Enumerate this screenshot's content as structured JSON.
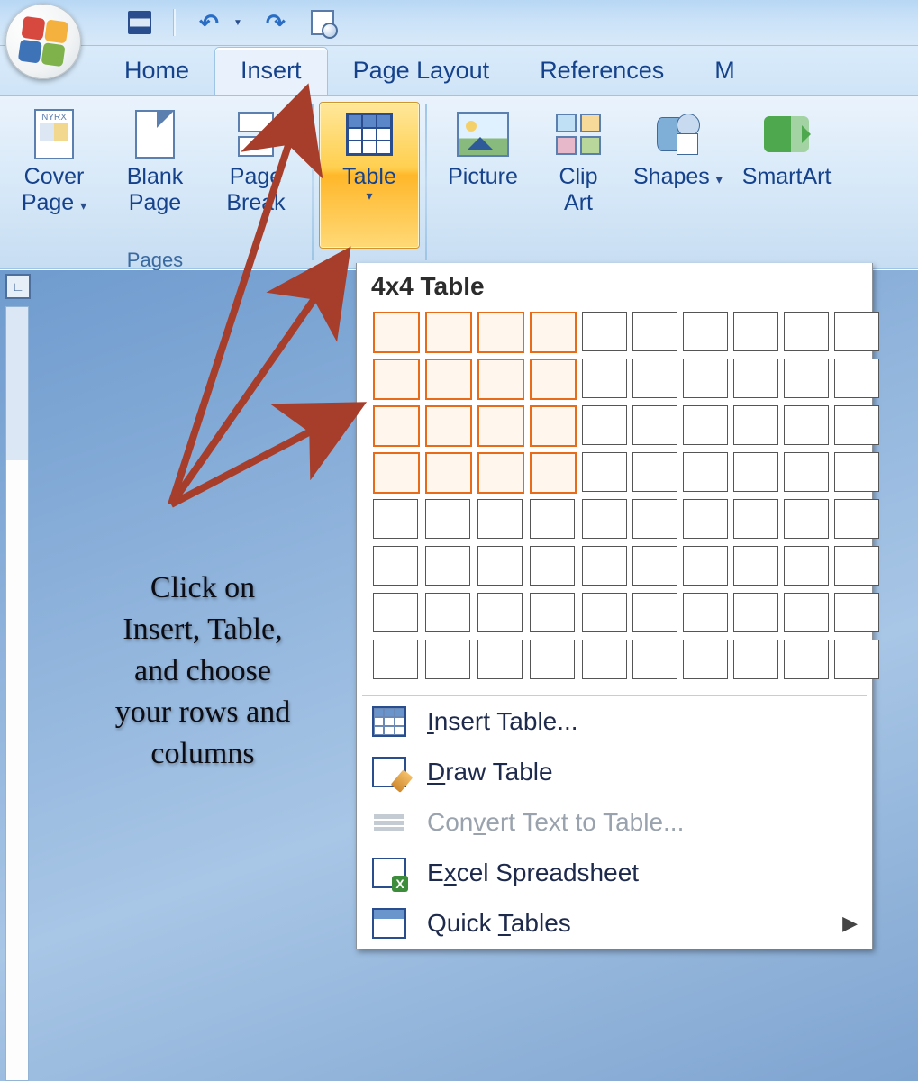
{
  "qat": {
    "undo_glyph": "↶",
    "redo_glyph": "↶"
  },
  "tabs": {
    "home": "Home",
    "insert": "Insert",
    "pagelayout": "Page Layout",
    "references": "References",
    "more": "M"
  },
  "ribbon": {
    "pages_group_label": "Pages",
    "cover_page": {
      "label1": "Cover",
      "label2": "Page",
      "dd": "▾",
      "icon_text": "NYRX"
    },
    "blank_page": {
      "label1": "Blank",
      "label2": "Page"
    },
    "page_break": {
      "label1": "Page",
      "label2": "Break"
    },
    "table": {
      "label": "Table",
      "dd": "▾"
    },
    "picture": {
      "label": "Picture"
    },
    "clip_art": {
      "label1": "Clip",
      "label2": "Art"
    },
    "shapes": {
      "label": "Shapes",
      "dd": "▾"
    },
    "smartart": {
      "label": "SmartArt"
    }
  },
  "table_menu": {
    "title": "4x4 Table",
    "selected_cols": 4,
    "selected_rows": 4,
    "total_cols": 10,
    "total_rows": 8,
    "items": {
      "insert": {
        "pre": "",
        "u": "I",
        "post": "nsert Table..."
      },
      "draw": {
        "pre": "",
        "u": "D",
        "post": "raw Table"
      },
      "convert": {
        "pre": "Con",
        "u": "v",
        "post": "ert Text to Table..."
      },
      "excel": {
        "pre": "E",
        "u": "x",
        "post": "cel Spreadsheet"
      },
      "quick": {
        "pre": "Quick ",
        "u": "T",
        "post": "ables"
      }
    },
    "arrow": "▶"
  },
  "annotation": {
    "l1": "Click on",
    "l2": "Insert, Table,",
    "l3": "and choose",
    "l4": "your rows and",
    "l5": "columns"
  },
  "corner_marker": "∟"
}
